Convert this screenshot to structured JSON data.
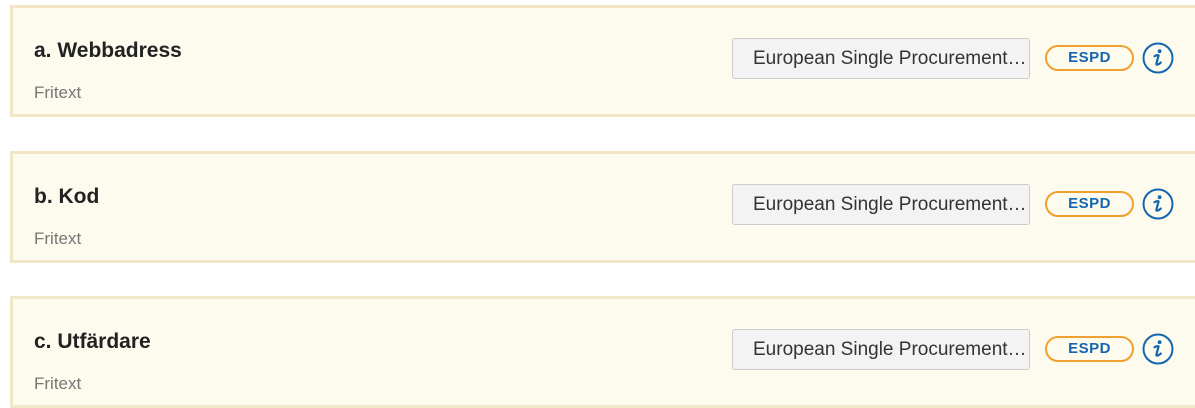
{
  "items": [
    {
      "title": "a. Webbadress",
      "subtitle": "Fritext",
      "source_button": "European Single Procurement Document",
      "badge": "ESPD"
    },
    {
      "title": "b. Kod",
      "subtitle": "Fritext",
      "source_button": "European Single Procurement Document",
      "badge": "ESPD"
    },
    {
      "title": "c. Utfärdare",
      "subtitle": "Fritext",
      "source_button": "European Single Procurement Document",
      "badge": "ESPD"
    }
  ],
  "colors": {
    "card_background": "#fdfaee",
    "card_border": "#f1e6c6",
    "badge_border": "#f0a030",
    "badge_text": "#1566b0",
    "info_icon": "#1566b0"
  },
  "icons": {
    "info": "info-icon"
  }
}
